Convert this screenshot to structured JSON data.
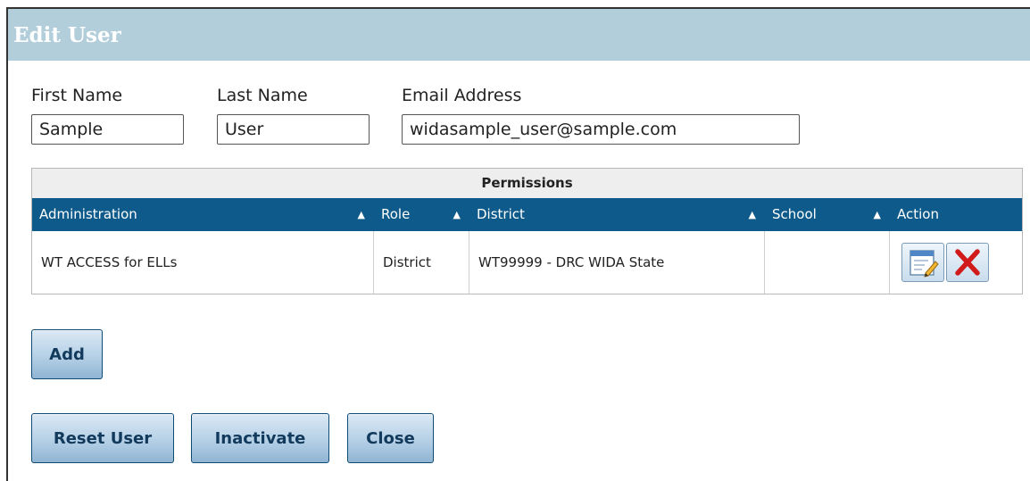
{
  "dialog": {
    "title": "Edit User"
  },
  "fields": {
    "first_name": {
      "label": "First Name",
      "value": "Sample"
    },
    "last_name": {
      "label": "Last Name",
      "value": "User"
    },
    "email": {
      "label": "Email Address",
      "value": "widasample_user@sample.com"
    }
  },
  "permissions": {
    "caption": "Permissions",
    "columns": [
      "Administration",
      "Role",
      "District",
      "School",
      "Action"
    ],
    "sort_glyph": "▲",
    "rows": [
      {
        "administration": "WT ACCESS for ELLs",
        "role": "District",
        "district": "WT99999 - DRC WIDA State",
        "school": ""
      }
    ],
    "row_actions": {
      "edit_icon": "edit-icon",
      "delete_icon": "delete-icon"
    }
  },
  "buttons": {
    "add": "Add",
    "reset_user": "Reset User",
    "inactivate": "Inactivate",
    "close": "Close"
  },
  "colors": {
    "title_bar": "#b3cedb",
    "header_bar": "#0e5a8a",
    "delete_red": "#d11a1a"
  }
}
